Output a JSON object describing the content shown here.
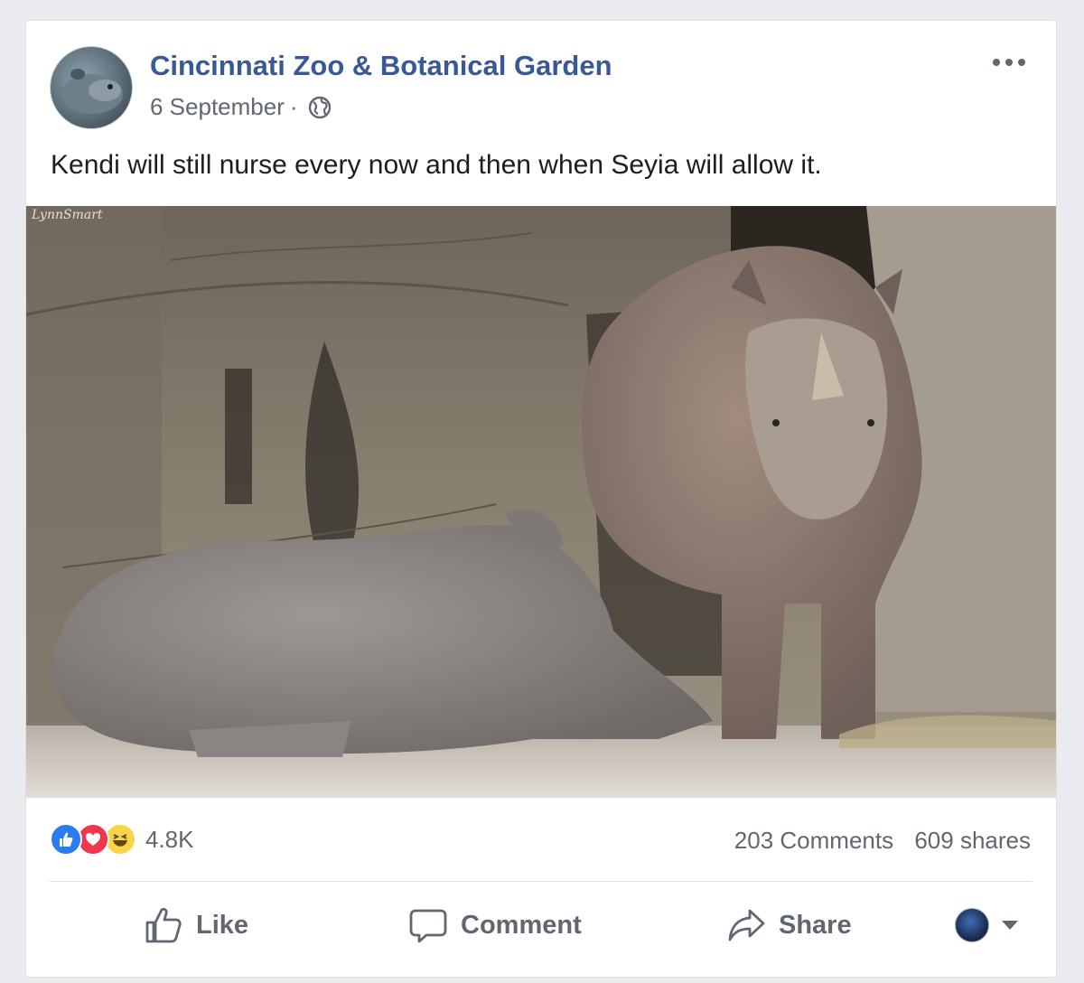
{
  "post": {
    "page_name": "Cincinnati Zoo & Botanical Garden",
    "date": "6 September",
    "separator": "·",
    "privacy_icon": "globe-icon",
    "more_icon": "more-options-icon",
    "message": "Kendi will still nurse every now and then when Seyia will allow it.",
    "photo_watermark": "LynnSmart"
  },
  "stats": {
    "reactions": [
      "like-icon",
      "love-icon",
      "haha-icon"
    ],
    "reaction_count": "4.8K",
    "comments": "203 Comments",
    "shares": "609 shares"
  },
  "actions": {
    "like": "Like",
    "comment": "Comment",
    "share": "Share"
  },
  "colors": {
    "page_name": "#385898",
    "like_blue": "#2b7bf2",
    "love_red": "#f0354f",
    "haha_yellow": "#f8d548",
    "secondary_text": "#606770"
  }
}
